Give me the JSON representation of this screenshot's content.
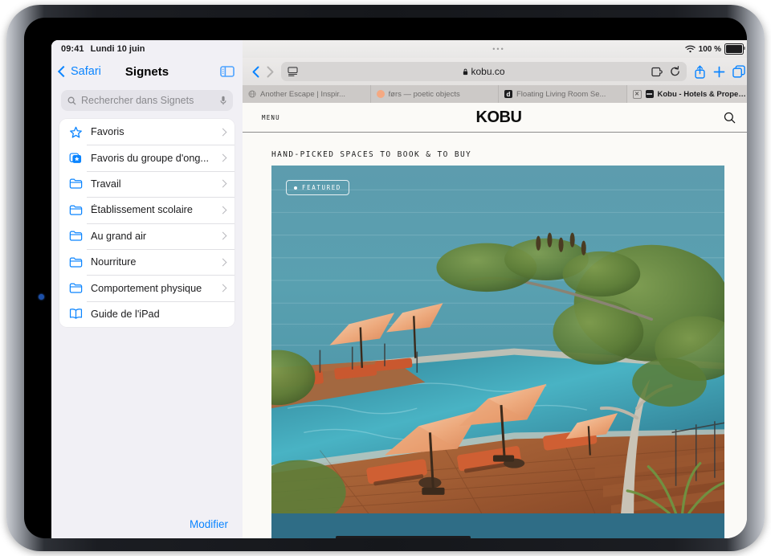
{
  "status_bar": {
    "time": "09:41",
    "date": "Lundi 10 juin",
    "wifi_icon": "wifi-icon",
    "battery_level": "100 %",
    "battery_icon": "battery-icon"
  },
  "sidebar": {
    "back_label": "Safari",
    "back_icon": "chevron-left-icon",
    "title": "Signets",
    "toggle_icon": "sidebar-toggle-icon",
    "search": {
      "placeholder": "Rechercher dans Signets",
      "value": "",
      "search_icon": "search-icon",
      "mic_icon": "microphone-icon"
    },
    "items": [
      {
        "label": "Favoris",
        "icon": "star-icon",
        "chevron": "chevron-right-icon"
      },
      {
        "label": "Favoris du groupe d'ong...",
        "icon": "shared-bookmarks-icon",
        "chevron": "chevron-right-icon"
      },
      {
        "label": "Travail",
        "icon": "folder-icon",
        "chevron": "chevron-right-icon"
      },
      {
        "label": "Établissement scolaire",
        "icon": "folder-icon",
        "chevron": "chevron-right-icon"
      },
      {
        "label": "Au grand air",
        "icon": "folder-icon",
        "chevron": "chevron-right-icon"
      },
      {
        "label": "Nourriture",
        "icon": "folder-icon",
        "chevron": "chevron-right-icon"
      },
      {
        "label": "Comportement physique",
        "icon": "folder-icon",
        "chevron": "chevron-right-icon"
      },
      {
        "label": "Guide de l'iPad",
        "icon": "book-icon",
        "chevron": ""
      }
    ],
    "edit_label": "Modifier",
    "accent_color": "#0a84ff"
  },
  "browser": {
    "window_grabber": "•••",
    "back_icon": "chevron-left-icon",
    "forward_icon": "chevron-right-icon",
    "address_bar": {
      "reader_icon": "reader-view-icon",
      "lock_icon": "lock-icon",
      "url": "kobu.co",
      "extension_icon": "extension-icon",
      "reload_icon": "reload-icon"
    },
    "share_icon": "share-icon",
    "new_tab_icon": "plus-icon",
    "tab_overview_icon": "tab-overview-icon",
    "tabs": [
      {
        "title": "Another Escape | Inspir...",
        "favicon": "globe-icon",
        "active": false,
        "closable": false
      },
      {
        "title": "førs — poetic objects",
        "favicon": "peach-circle-icon",
        "active": false,
        "closable": false
      },
      {
        "title": "Floating Living Room Se...",
        "favicon": "letter-d-icon",
        "active": false,
        "closable": false
      },
      {
        "title": "Kobu - Hotels & Propert...",
        "favicon": "kobu-icon",
        "active": true,
        "closable": true
      }
    ]
  },
  "page": {
    "menu_label": "MENU",
    "logo": "KOBU",
    "search_icon": "search-icon",
    "tagline": "HAND-PICKED SPACES TO BOOK & TO BUY",
    "hero": {
      "badge_label": "FEATURED",
      "badge_dot": "dot-icon",
      "alt": "Aerial view of an infinity pool on a wooden deck with orange umbrellas and loungers overlooking the ocean"
    }
  },
  "colors": {
    "ios_blue": "#0a84ff",
    "page_bg": "#fbfaf7",
    "ocean": "#4f93a6",
    "umbrella": "#e8a07a",
    "deck": "#a4643a"
  }
}
